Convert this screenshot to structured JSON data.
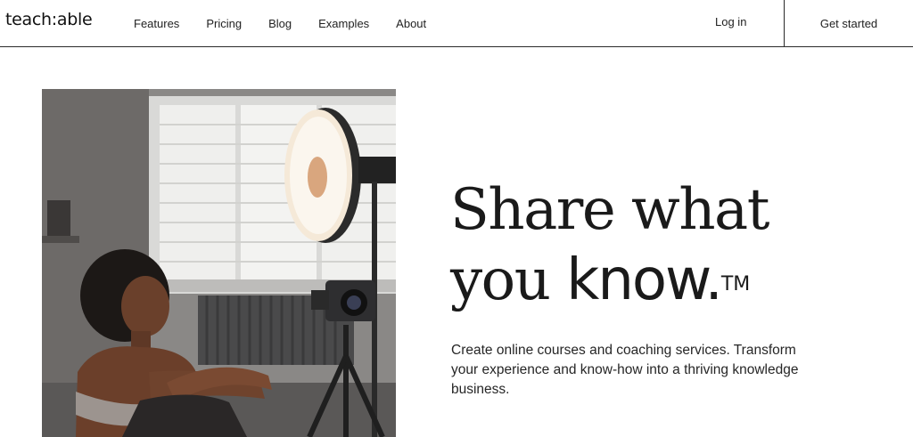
{
  "header": {
    "logo": "teach:able",
    "nav": [
      "Features",
      "Pricing",
      "Blog",
      "Examples",
      "About"
    ],
    "login_label": "Log in",
    "cta_label": "Get started"
  },
  "hero": {
    "headline_line1": "Share what",
    "headline_line2_serif": "you ",
    "headline_line2_sans": "know.",
    "trademark": "TM",
    "subtext": "Create online courses and coaching services. Transform your experience and know-how into a thriving knowledge business."
  }
}
